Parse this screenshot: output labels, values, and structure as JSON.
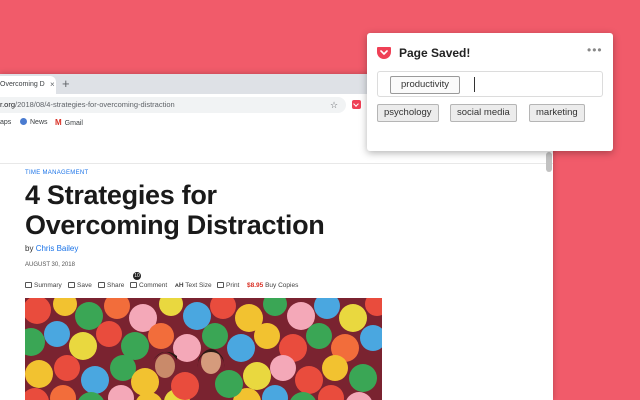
{
  "browser": {
    "tab_title": "Overcoming D",
    "tab_close": "×",
    "new_tab": "+",
    "url_host": "r.org",
    "url_path": "/2018/08/4-strategies-for-overcoming-distraction",
    "star_glyph": "☆",
    "bookmarks": [
      {
        "label": "aps",
        "icon": "apps-icon"
      },
      {
        "label": "News",
        "icon": "news-icon"
      },
      {
        "label": "Gmail",
        "icon": "gmail-icon"
      }
    ]
  },
  "article": {
    "category": "TIME MANAGEMENT",
    "title_line1": "4 Strategies for",
    "title_line2": "Overcoming Distraction",
    "by": "by",
    "author": "Chris Bailey",
    "date": "AUGUST 30, 2018",
    "actions": {
      "summary": "Summary",
      "save": "Save",
      "share": "Share",
      "comment": "Comment",
      "comment_count": "10",
      "text_size": "Text Size",
      "text_size_glyph": "ᴀH",
      "print": "Print",
      "price": "$8.95",
      "buy": "Buy Copies"
    }
  },
  "pocket": {
    "title": "Page Saved!",
    "more": "•••",
    "tag": "productivity",
    "suggestions": [
      "psychology",
      "social media",
      "marketing"
    ],
    "accent": "#ef4056"
  },
  "colors": {
    "background": "#f15b6a",
    "link": "#1a73e8"
  }
}
